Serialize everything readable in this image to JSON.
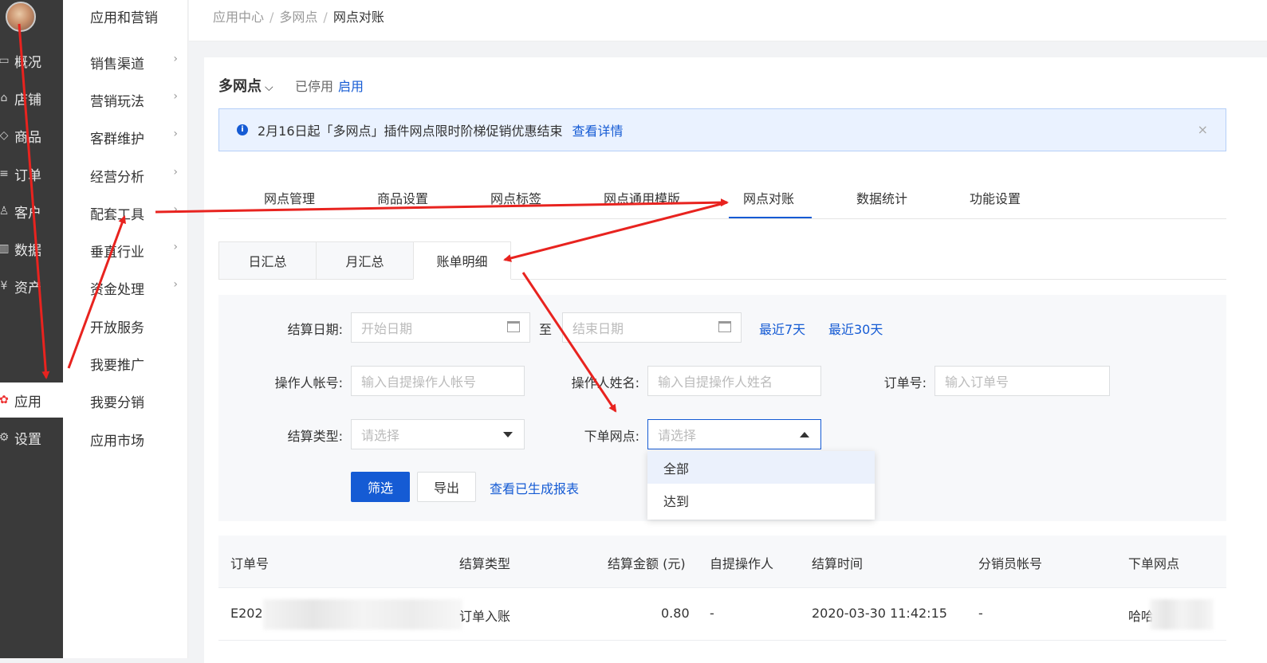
{
  "rail": {
    "items": [
      {
        "label": "概况",
        "icon": "monitor-icon"
      },
      {
        "label": "店铺",
        "icon": "store-icon"
      },
      {
        "label": "商品",
        "icon": "tag-icon"
      },
      {
        "label": "订单",
        "icon": "list-icon"
      },
      {
        "label": "客户",
        "icon": "user-icon"
      },
      {
        "label": "数据",
        "icon": "chart-icon"
      },
      {
        "label": "资产",
        "icon": "yen-icon"
      },
      {
        "label": "应用",
        "icon": "apps-icon",
        "active": true
      },
      {
        "label": "设置",
        "icon": "gear-icon"
      }
    ]
  },
  "submenu": {
    "title": "应用和营销",
    "items": [
      {
        "label": "销售渠道",
        "chevron": true
      },
      {
        "label": "营销玩法",
        "chevron": true
      },
      {
        "label": "客群维护",
        "chevron": true
      },
      {
        "label": "经营分析",
        "chevron": true
      },
      {
        "label": "配套工具",
        "chevron": true
      },
      {
        "label": "垂直行业",
        "chevron": true
      },
      {
        "label": "资金处理",
        "chevron": true
      },
      {
        "label": "开放服务",
        "chevron": false
      },
      {
        "label": "我要推广",
        "chevron": false
      },
      {
        "label": "我要分销",
        "chevron": false
      },
      {
        "label": "应用市场",
        "chevron": false
      }
    ]
  },
  "breadcrumb": [
    "应用中心",
    "多网点",
    "网点对账"
  ],
  "breadcrumb_sep": "/",
  "header": {
    "title": "多网点",
    "status_label": "已停用",
    "enable_link": "启用"
  },
  "notice": {
    "text": "2月16日起「多网点」插件网点限时阶梯促销优惠结束",
    "link": "查看详情",
    "close": "×"
  },
  "tabs": [
    "网点管理",
    "商品设置",
    "网点标签",
    "网点通用模版",
    "网点对账",
    "数据统计",
    "功能设置"
  ],
  "active_tab": "网点对账",
  "subtabs": [
    "日汇总",
    "月汇总",
    "账单明细"
  ],
  "active_subtab": "账单明细",
  "filter": {
    "date_label": "结算日期:",
    "start_placeholder": "开始日期",
    "to": "至",
    "end_placeholder": "结束日期",
    "last7": "最近7天",
    "last30": "最近30天",
    "operator_account_label": "操作人帐号:",
    "operator_account_placeholder": "输入自提操作人帐号",
    "operator_name_label": "操作人姓名:",
    "operator_name_placeholder": "输入自提操作人姓名",
    "order_no_label": "订单号:",
    "order_no_placeholder": "输入订单号",
    "settle_type_label": "结算类型:",
    "settle_type_placeholder": "请选择",
    "store_label": "下单网点:",
    "store_placeholder": "请选择",
    "filter_button": "筛选",
    "export_button": "导出",
    "report_link": "查看已生成报表"
  },
  "dropdown_options": [
    "全部",
    "达到"
  ],
  "table": {
    "headers": [
      "订单号",
      "结算类型",
      "结算金额 (元)",
      "自提操作人",
      "结算时间",
      "分销员帐号",
      "下单网点"
    ],
    "rows": [
      [
        "E202",
        "订单入账",
        "0.80",
        "-",
        "2020-03-30 11:42:15",
        "-",
        "哈哈"
      ]
    ]
  },
  "colors": {
    "accent": "#155bd4",
    "rail_bg": "#3a3a3a",
    "annotation_arrow": "#e8231f"
  }
}
